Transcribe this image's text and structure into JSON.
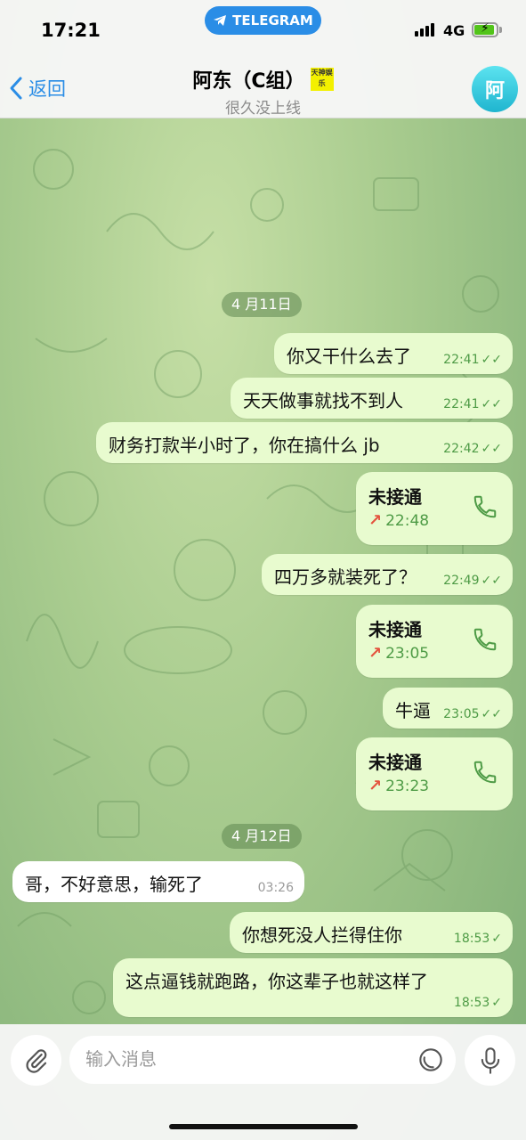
{
  "status_bar": {
    "time": "17:21",
    "app_pill": "TELEGRAM",
    "network": "4G"
  },
  "header": {
    "back_label": "返回",
    "contact_name": "阿东（C组）",
    "badge_text": "天神娱乐",
    "status": "很久没上线",
    "avatar_letter": "阿"
  },
  "messages": [
    {
      "kind": "date",
      "text": "4 月11日"
    },
    {
      "kind": "out",
      "text": "你又干什么去了",
      "time": "22:41",
      "checks": "✓✓"
    },
    {
      "kind": "out",
      "text": "天天做事就找不到人",
      "time": "22:41",
      "checks": "✓✓"
    },
    {
      "kind": "out",
      "text": "财务打款半小时了，你在搞什么 jb",
      "time": "22:42",
      "checks": "✓✓"
    },
    {
      "kind": "call",
      "text": "未接通",
      "time": "22:48"
    },
    {
      "kind": "out",
      "text": "四万多就装死了？",
      "time": "22:49",
      "checks": "✓✓"
    },
    {
      "kind": "call",
      "text": "未接通",
      "time": "23:05"
    },
    {
      "kind": "out",
      "text": "牛逼",
      "time": "23:05",
      "checks": "✓✓"
    },
    {
      "kind": "call",
      "text": "未接通",
      "time": "23:23"
    },
    {
      "kind": "date",
      "text": "4 月12日"
    },
    {
      "kind": "in",
      "text": "哥，不好意思，输死了",
      "time": "03:26"
    },
    {
      "kind": "out",
      "text": "你想死没人拦得住你",
      "time": "18:53",
      "checks": "✓"
    },
    {
      "kind": "out",
      "text": "这点逼钱就跑路，你这辈子也就这样了",
      "time": "18:53",
      "checks": "✓"
    }
  ],
  "composer": {
    "placeholder": "输入消息"
  },
  "colors": {
    "accent": "#2a8de6",
    "out_bubble": "#e8fbcf",
    "meta_green": "#4e9b46",
    "missed_red": "#e4533e"
  },
  "icons": [
    "chevron-left-icon",
    "telegram-plane-icon",
    "phone-icon",
    "paperclip-icon",
    "sticker-icon",
    "microphone-icon"
  ]
}
